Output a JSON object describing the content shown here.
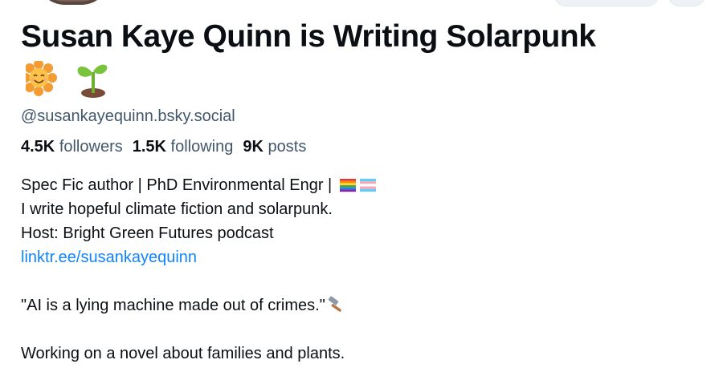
{
  "profile": {
    "display_name": "Susan Kaye Quinn is Writing Solarpunk",
    "emojis": [
      "sun-flower-emoji",
      "seedling-emoji"
    ],
    "handle": "@susankayequinn.bsky.social",
    "stats": {
      "followers_count": "4.5K",
      "followers_label": "followers",
      "following_count": "1.5K",
      "following_label": "following",
      "posts_count": "9K",
      "posts_label": "posts"
    },
    "bio": {
      "line1": "Spec Fic author | PhD Environmental Engr | ",
      "line1_flags": [
        "rainbow-pride-flag-emoji",
        "transgender-flag-emoji"
      ],
      "line2": "I write hopeful climate fiction and solarpunk.",
      "line3": "Host: Bright Green Futures podcast",
      "link": "linktr.ee/susankayequinn",
      "quote": "\"AI is a lying machine made out of crimes.\"",
      "quote_emoji": "hammer-emoji",
      "line6": "Working on a novel about families and plants."
    }
  },
  "colors": {
    "text": "#0b0f14",
    "muted": "#42576c",
    "link": "#1083fe"
  }
}
